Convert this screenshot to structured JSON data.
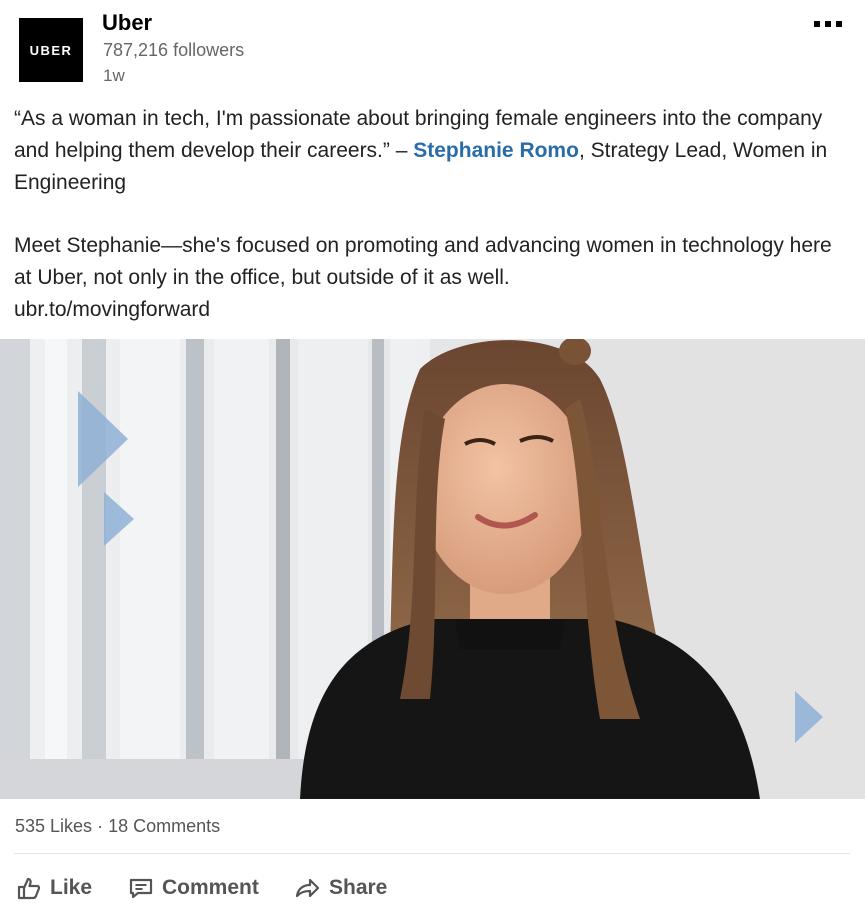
{
  "post": {
    "company": "Uber",
    "logo_text": "UBER",
    "followers": "787,216 followers",
    "time": "1w",
    "quote_part1": "“As a woman in tech, I'm passionate about bringing female engineers into the company and helping them develop their careers.” – ",
    "mention": "Stephanie Romo",
    "quote_part2": ", Strategy Lead, Women in Engineering",
    "body_text": "Meet Stephanie—she's focused on promoting and advancing women in technology here at Uber, not only in the office, but outside of it as well.",
    "link_text": "ubr.to/movingforward"
  },
  "stats": {
    "likes": "535 Likes",
    "separator": "·",
    "comments": "18 Comments"
  },
  "actions": {
    "like": "Like",
    "comment": "Comment",
    "share": "Share"
  },
  "icons": {
    "more": "more-options-icon",
    "like": "thumbs-up-icon",
    "comment": "comment-icon",
    "share": "share-arrow-icon"
  },
  "colors": {
    "mention": "#2a6ca8",
    "accent_triangles": "#8fb0d6"
  }
}
